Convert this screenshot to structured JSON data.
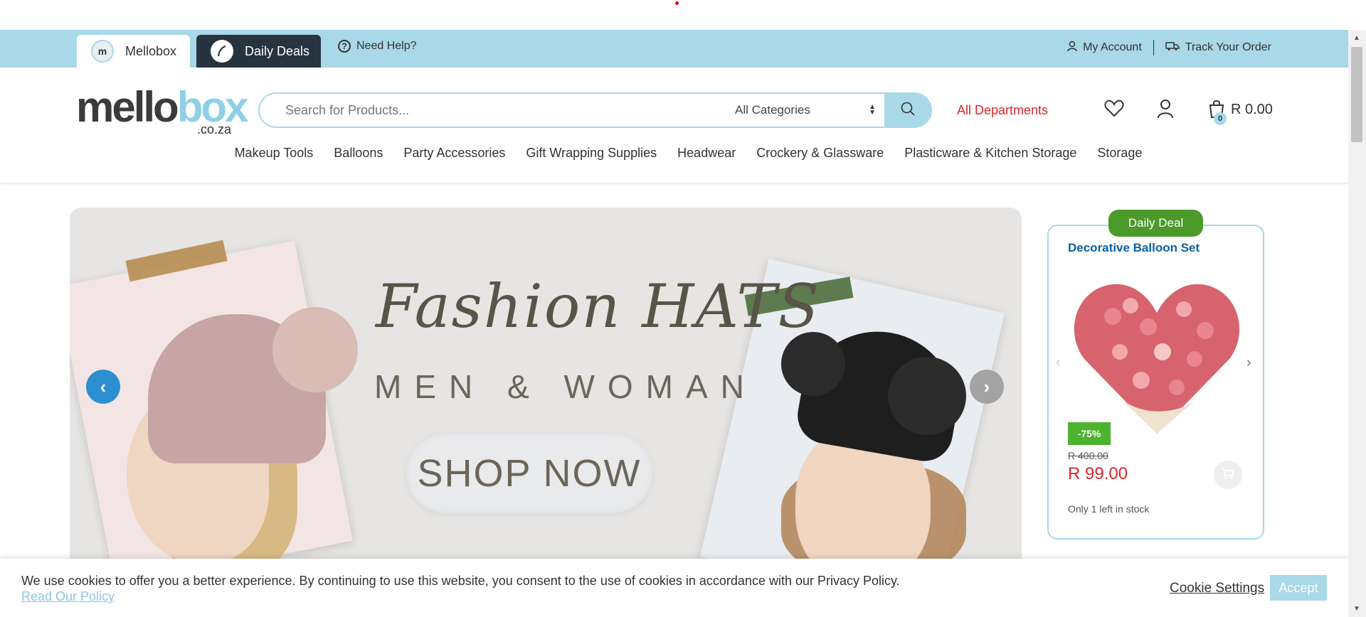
{
  "topbar": {
    "tabs": [
      {
        "label": "Mellobox",
        "logo": "m"
      },
      {
        "label": "Daily Deals"
      }
    ],
    "help": "Need Help?",
    "account": "My Account",
    "track": "Track Your Order"
  },
  "header": {
    "brand_main": "mello",
    "brand_accent": "box",
    "brand_suffix": ".co.za",
    "search_placeholder": "Search for Products...",
    "category_select": "All Categories",
    "all_departments": "All Departments",
    "cart_count": "0",
    "cart_total": "R 0.00"
  },
  "nav": [
    "Makeup Tools",
    "Balloons",
    "Party Accessories",
    "Gift Wrapping Supplies",
    "Headwear",
    "Crockery & Glassware",
    "Plasticware & Kitchen Storage",
    "Storage"
  ],
  "hero": {
    "title": "Fashion HATS",
    "subtitle": "MEN & WOMAN",
    "cta": "SHOP NOW"
  },
  "deal": {
    "badge": "Daily Deal",
    "title": "Decorative Balloon Set",
    "discount": "-75%",
    "old_price": "R 400.00",
    "price": "R 99.00",
    "stock": "Only 1 left in stock"
  },
  "cookie": {
    "message": "We use cookies to offer you a better experience. By continuing to use this website, you consent to the use of cookies in accordance with our Privacy Policy.",
    "policy_link": "Read Our Policy",
    "settings": "Cookie Settings",
    "accept": "Accept"
  },
  "colors": {
    "accent": "#a9d8e8",
    "brand_dark": "#3b3b3b",
    "red": "#d9262c",
    "deal_green": "#4c9a2a",
    "link_blue": "#0b5fa5"
  },
  "icons": [
    "question-icon",
    "user-icon",
    "truck-icon",
    "search-icon",
    "heart-icon",
    "cart-icon",
    "chevron-left-icon",
    "chevron-right-icon",
    "add-to-cart-icon"
  ]
}
